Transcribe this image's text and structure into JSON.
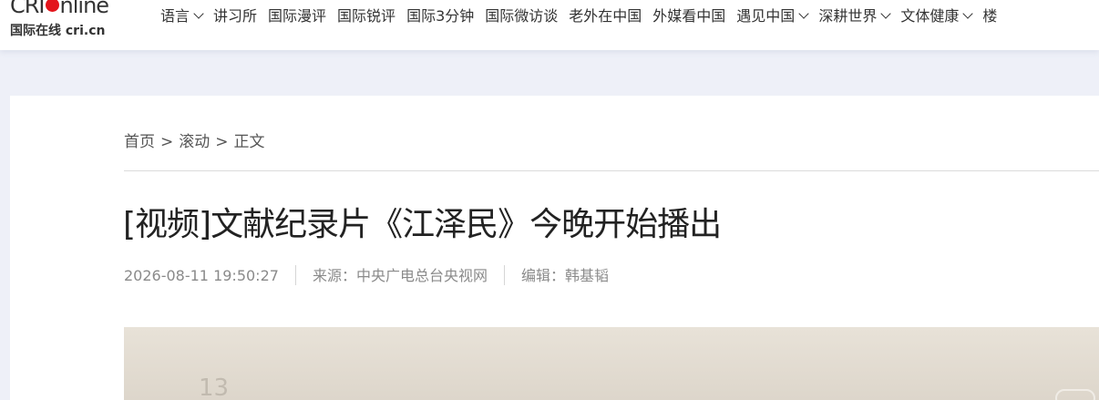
{
  "logo": {
    "top": "CRI",
    "top_suffix": "nline",
    "bottom": "国际在线 cri.cn"
  },
  "nav": [
    {
      "label": "语言",
      "dropdown": true
    },
    {
      "label": "讲习所",
      "dropdown": false
    },
    {
      "label": "国际漫评",
      "dropdown": false
    },
    {
      "label": "国际锐评",
      "dropdown": false
    },
    {
      "label": "国际3分钟",
      "dropdown": false
    },
    {
      "label": "国际微访谈",
      "dropdown": false
    },
    {
      "label": "老外在中国",
      "dropdown": false
    },
    {
      "label": "外媒看中国",
      "dropdown": false
    },
    {
      "label": "遇见中国",
      "dropdown": true
    },
    {
      "label": "深耕世界",
      "dropdown": true
    },
    {
      "label": "文体健康",
      "dropdown": true
    },
    {
      "label": "楼",
      "dropdown": false
    }
  ],
  "breadcrumb": {
    "items": [
      "首页",
      "滚动",
      "正文"
    ],
    "separator": ">"
  },
  "article": {
    "title": "[视频]文献纪录片《江泽民》今晚开始播出",
    "date": "2026-08-11 19:50:27",
    "source": "来源：中央广电总台央视网",
    "editor": "编辑：韩基韬"
  },
  "video": {
    "watermark": "13"
  },
  "colors": {
    "page_bg": "#eef0f8",
    "logo_dot": "#e3141b",
    "meta_text": "#8a8a8a"
  }
}
